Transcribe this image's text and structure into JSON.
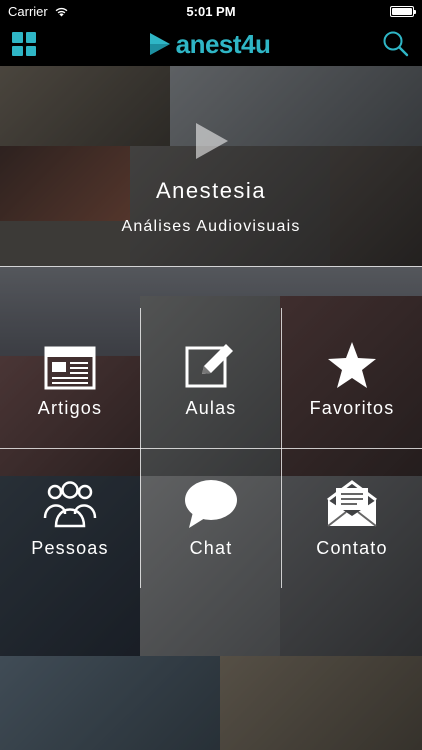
{
  "status": {
    "carrier": "Carrier",
    "time": "5:01 PM",
    "battery_level": 1.0
  },
  "header": {
    "logo_text": "anest4u",
    "accent_color": "#2fb6c6",
    "menu_icon": "grid-icon",
    "search_icon": "search-icon"
  },
  "hero": {
    "title": "Anestesia",
    "subtitle": "Análises Audiovisuais",
    "icon": "play-icon"
  },
  "menu": [
    {
      "label": "Artigos",
      "icon": "newspaper-icon"
    },
    {
      "label": "Aulas",
      "icon": "edit-icon"
    },
    {
      "label": "Favoritos",
      "icon": "star-icon"
    },
    {
      "label": "Pessoas",
      "icon": "people-icon"
    },
    {
      "label": "Chat",
      "icon": "chat-bubble-icon"
    },
    {
      "label": "Contato",
      "icon": "envelope-icon"
    }
  ]
}
